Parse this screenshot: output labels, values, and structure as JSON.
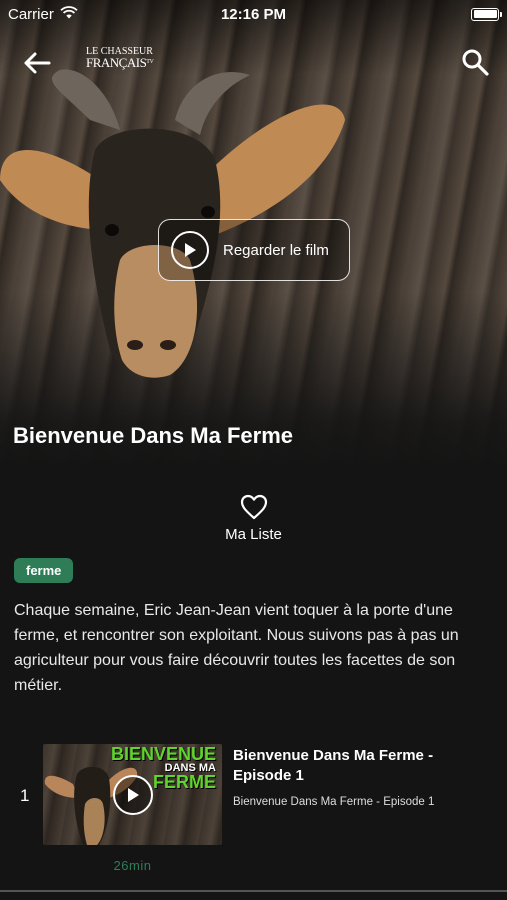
{
  "status_bar": {
    "carrier": "Carrier",
    "time": "12:16 PM"
  },
  "header": {
    "logo_line1": "LE CHASSEUR",
    "logo_line2": "FRANÇAIS",
    "logo_suffix": "TV"
  },
  "hero": {
    "watch_label": "Regarder le film",
    "title": "Bienvenue Dans Ma Ferme"
  },
  "actions": {
    "my_list_label": "Ma Liste"
  },
  "tag": "ferme",
  "description": "Chaque semaine, Eric Jean-Jean vient toquer à la porte d'une ferme, et rencontrer son exploitant. Nous suivons pas à pas un agriculteur pour vous faire découvrir toutes les facettes de son métier.",
  "episodes": [
    {
      "number": "1",
      "title": "Bienvenue Dans Ma Ferme - Episode 1",
      "subtitle": "Bienvenue Dans Ma Ferme - Episode 1",
      "duration": "26min",
      "thumb_text_1": "BIENVENUE",
      "thumb_text_2": "DANS MA",
      "thumb_text_3": "FERME"
    }
  ],
  "colors": {
    "accent": "#2e7d57",
    "background": "#141414"
  }
}
